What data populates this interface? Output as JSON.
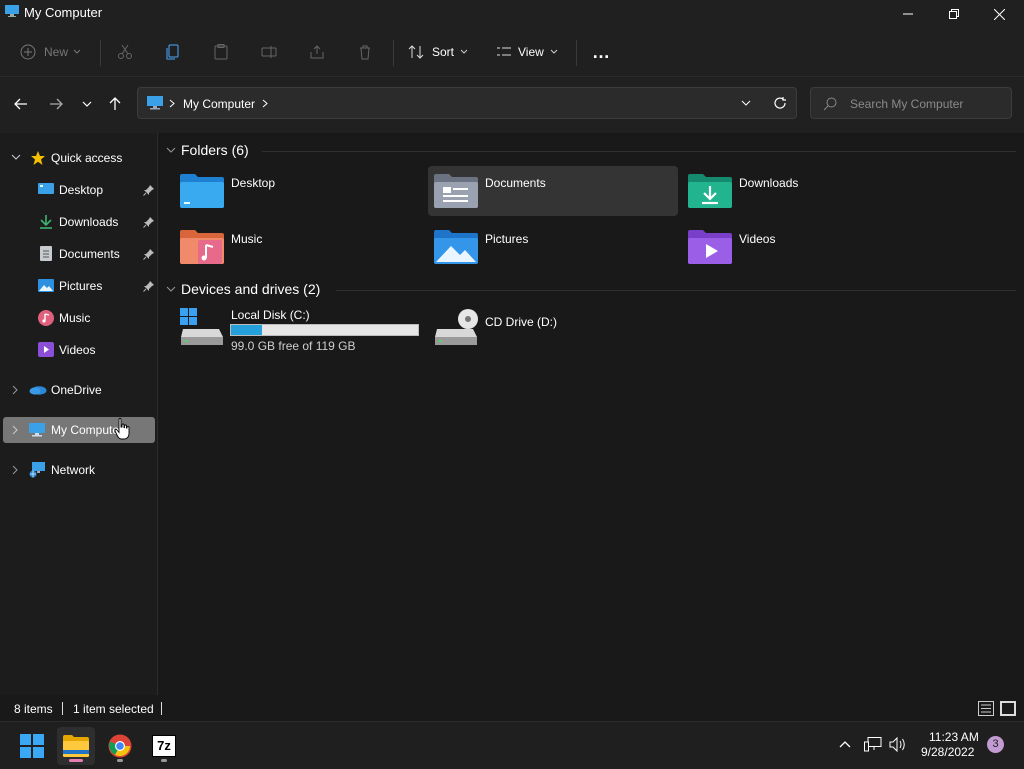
{
  "window": {
    "title": "My Computer"
  },
  "toolbar": {
    "new_label": "New",
    "sort_label": "Sort",
    "view_label": "View",
    "more_label": "…"
  },
  "address": {
    "current": "My Computer",
    "search_placeholder": "Search My Computer"
  },
  "sidebar": {
    "quick_access": "Quick access",
    "items": [
      {
        "label": "Desktop",
        "pinned": true
      },
      {
        "label": "Downloads",
        "pinned": true
      },
      {
        "label": "Documents",
        "pinned": true
      },
      {
        "label": "Pictures",
        "pinned": true
      },
      {
        "label": "Music",
        "pinned": false
      },
      {
        "label": "Videos",
        "pinned": false
      }
    ],
    "onedrive": "OneDrive",
    "mycomputer": "My Computer",
    "network": "Network"
  },
  "content": {
    "folders_header": "Folders (6)",
    "folders": [
      {
        "label": "Desktop",
        "icon": "desktop-folder-icon"
      },
      {
        "label": "Documents",
        "icon": "documents-folder-icon"
      },
      {
        "label": "Downloads",
        "icon": "downloads-folder-icon"
      },
      {
        "label": "Music",
        "icon": "music-folder-icon"
      },
      {
        "label": "Pictures",
        "icon": "pictures-folder-icon"
      },
      {
        "label": "Videos",
        "icon": "videos-folder-icon"
      }
    ],
    "drives_header": "Devices and drives (2)",
    "drives": [
      {
        "label": "Local Disk (C:)",
        "free_text": "99.0 GB free of 119 GB",
        "used_fraction": 0.168
      },
      {
        "label": "CD Drive (D:)"
      }
    ]
  },
  "status": {
    "items": "8 items",
    "selected": "1 item selected"
  },
  "taskbar": {
    "time": "11:23 AM",
    "date": "9/28/2022",
    "notifications": "3",
    "sevenzip_label": "7z"
  },
  "colors": {
    "accent": "#0078d4",
    "drive_bar": "#26a0da",
    "selected_bg": "#777777",
    "notification_badge": "#c39bd3"
  }
}
